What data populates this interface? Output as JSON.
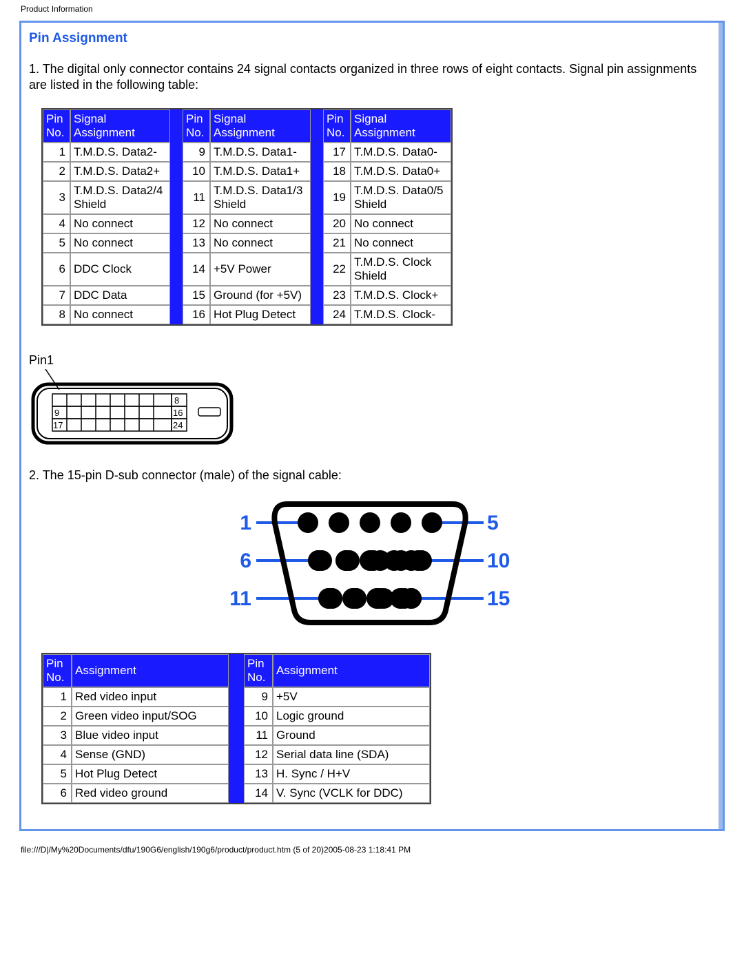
{
  "header": {
    "title": "Product Information"
  },
  "section": {
    "title": "Pin Assignment",
    "intro": "1. The digital only connector contains 24 signal contacts organized in three rows of eight contacts. Signal pin assignments are listed in the following table:",
    "intro2": "2. The 15-pin D-sub connector (male) of the signal cable:"
  },
  "dvi_table": {
    "headers": {
      "pin": "Pin No.",
      "sig": "Signal Assignment"
    },
    "colA": [
      {
        "n": "1",
        "s": "T.M.D.S. Data2-"
      },
      {
        "n": "2",
        "s": "T.M.D.S. Data2+"
      },
      {
        "n": "3",
        "s": "T.M.D.S. Data2/4 Shield"
      },
      {
        "n": "4",
        "s": "No connect"
      },
      {
        "n": "5",
        "s": "No connect"
      },
      {
        "n": "6",
        "s": "DDC Clock"
      },
      {
        "n": "7",
        "s": "DDC Data"
      },
      {
        "n": "8",
        "s": "No connect"
      }
    ],
    "colB": [
      {
        "n": "9",
        "s": "T.M.D.S. Data1-"
      },
      {
        "n": "10",
        "s": "T.M.D.S. Data1+"
      },
      {
        "n": "11",
        "s": "T.M.D.S. Data1/3 Shield"
      },
      {
        "n": "12",
        "s": "No connect"
      },
      {
        "n": "13",
        "s": "No connect"
      },
      {
        "n": "14",
        "s": "+5V Power"
      },
      {
        "n": "15",
        "s": "Ground (for +5V)"
      },
      {
        "n": "16",
        "s": "Hot Plug Detect"
      }
    ],
    "colC": [
      {
        "n": "17",
        "s": "T.M.D.S. Data0-"
      },
      {
        "n": "18",
        "s": "T.M.D.S. Data0+"
      },
      {
        "n": "19",
        "s": "T.M.D.S. Data0/5 Shield"
      },
      {
        "n": "20",
        "s": "No connect"
      },
      {
        "n": "21",
        "s": "No connect"
      },
      {
        "n": "22",
        "s": "T.M.D.S. Clock Shield"
      },
      {
        "n": "23",
        "s": "T.M.D.S. Clock+"
      },
      {
        "n": "24",
        "s": "T.M.D.S. Clock-"
      }
    ]
  },
  "dvi_diagram": {
    "pin1": "Pin1",
    "labels": {
      "r1": "8",
      "l2": "9",
      "r2": "16",
      "l3": "17",
      "r3": "24"
    }
  },
  "dsub_diagram": {
    "l1": "1",
    "r1": "5",
    "l2": "6",
    "r2": "10",
    "l3": "11",
    "r3": "15"
  },
  "dsub_table": {
    "headers": {
      "pin": "Pin No.",
      "asg": "Assignment"
    },
    "colA": [
      {
        "n": "1",
        "a": "Red video input"
      },
      {
        "n": "2",
        "a": "Green video input/SOG"
      },
      {
        "n": "3",
        "a": "Blue video input"
      },
      {
        "n": "4",
        "a": "Sense (GND)"
      },
      {
        "n": "5",
        "a": "Hot Plug Detect"
      },
      {
        "n": "6",
        "a": "Red video ground"
      }
    ],
    "colB": [
      {
        "n": "9",
        "a": "+5V"
      },
      {
        "n": "10",
        "a": "Logic ground"
      },
      {
        "n": "11",
        "a": "Ground"
      },
      {
        "n": "12",
        "a": "Serial data line (SDA)"
      },
      {
        "n": "13",
        "a": "H. Sync / H+V"
      },
      {
        "n": "14",
        "a": "V. Sync (VCLK for DDC)"
      }
    ]
  },
  "footer": {
    "path": "file:///D|/My%20Documents/dfu/190G6/english/190g6/product/product.htm (5 of 20)2005-08-23 1:18:41 PM"
  }
}
